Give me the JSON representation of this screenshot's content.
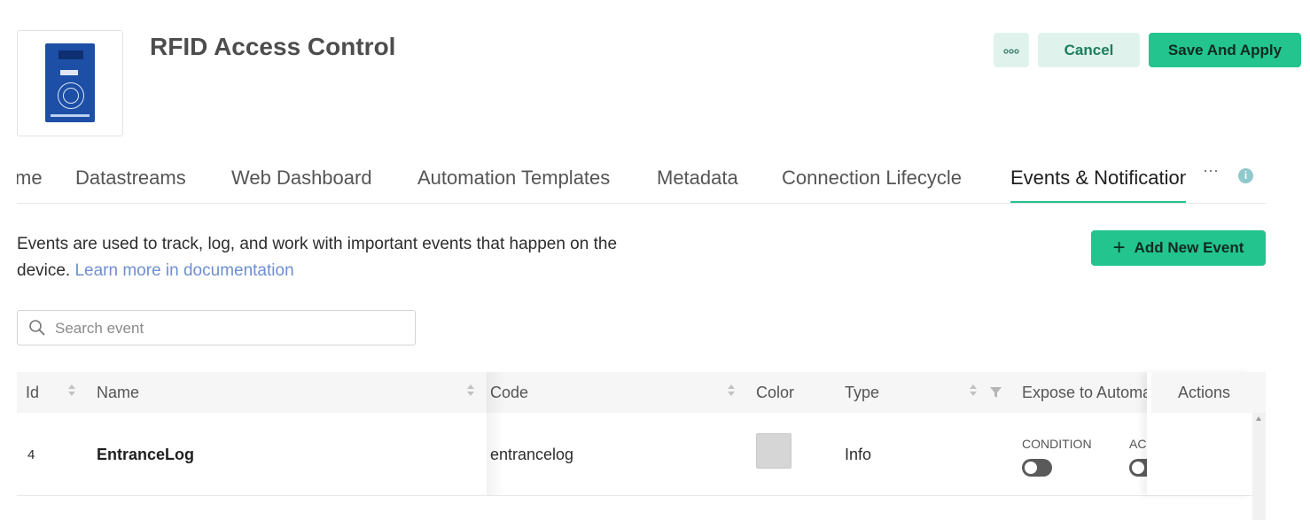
{
  "header": {
    "title": "RFID Access Control",
    "device_image": "RFID-RC522 board",
    "more_icon": "more-horizontal-icon",
    "cancel_label": "Cancel",
    "save_label": "Save And Apply"
  },
  "tabs": {
    "items": [
      {
        "label": "me"
      },
      {
        "label": "Datastreams"
      },
      {
        "label": "Web Dashboard"
      },
      {
        "label": "Automation Templates"
      },
      {
        "label": "Metadata"
      },
      {
        "label": "Connection Lifecycle"
      },
      {
        "label": "Events & Notifications",
        "active": true
      }
    ],
    "more_label": "···",
    "info_icon": "info-icon"
  },
  "events": {
    "description": "Events are used to track, log, and work with important events that happen on the device.",
    "learn_more": "Learn more in documentation",
    "add_label": "Add New Event",
    "search_placeholder": "Search event",
    "columns": {
      "id": "Id",
      "name": "Name",
      "code": "Code",
      "color": "Color",
      "type": "Type",
      "expose": "Expose to Automa",
      "actions": "Actions"
    },
    "rows": [
      {
        "id": "4",
        "name": "EntranceLog",
        "code": "entrancelog",
        "color_value": "#d6d6d6",
        "type": "Info",
        "condition_label": "CONDITION",
        "action_label": "AC",
        "condition_on": false,
        "action_on": false
      }
    ]
  },
  "colors": {
    "accent": "#23c48e",
    "accent_light": "#dff3ec",
    "link": "#6f8fcf"
  }
}
